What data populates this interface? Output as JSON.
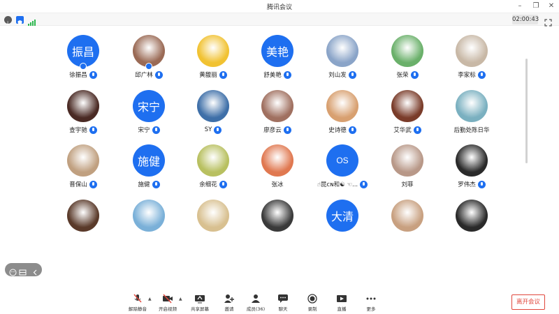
{
  "window": {
    "title": "腾讯会议"
  },
  "status": {
    "timer": "02:00:43",
    "colors": {
      "info": "#555555",
      "shield": "#1e6ff0",
      "signal": "#2eb84f"
    }
  },
  "participants": [
    {
      "name": "徐振昌",
      "avatar_text": "振昌",
      "avatar_type": "text",
      "host": true,
      "mic": "on"
    },
    {
      "name": "邱广林",
      "avatar_type": "photo",
      "avatar_color": "#9a6a55",
      "host": true,
      "mic": "on"
    },
    {
      "name": "黄馥丽",
      "avatar_type": "photo",
      "avatar_color": "#f1c232",
      "mic": "on"
    },
    {
      "name": "舒美艳",
      "avatar_text": "美艳",
      "avatar_type": "text",
      "mic": "on"
    },
    {
      "name": "刘山发",
      "avatar_type": "photo",
      "avatar_color": "#8aa4c8",
      "mic": "on"
    },
    {
      "name": "张荣",
      "avatar_type": "photo",
      "avatar_color": "#6ab06a",
      "mic": "on"
    },
    {
      "name": "李家标",
      "avatar_type": "photo",
      "avatar_color": "#c8b8a6",
      "mic": "on"
    },
    {
      "name": "查宇驰",
      "avatar_type": "photo",
      "avatar_color": "#4a2a24",
      "mic": "on"
    },
    {
      "name": "宋宁",
      "avatar_text": "宋宁",
      "avatar_type": "text",
      "mic": "on"
    },
    {
      "name": "SY",
      "avatar_type": "photo",
      "avatar_color": "#3e6fa8",
      "mic": "on"
    },
    {
      "name": "廖彦云",
      "avatar_type": "photo",
      "avatar_color": "#a07060",
      "mic": "on"
    },
    {
      "name": "史诗德",
      "avatar_type": "photo",
      "avatar_color": "#d8a070",
      "mic": "on"
    },
    {
      "name": "艾华武",
      "avatar_type": "photo",
      "avatar_color": "#7a3c2a",
      "mic": "on"
    },
    {
      "name": "后勤处陈日华",
      "avatar_type": "photo",
      "avatar_color": "#7ab0c0",
      "mic": "none"
    },
    {
      "name": "晋保山",
      "avatar_type": "photo",
      "avatar_color": "#c0a080",
      "mic": "on"
    },
    {
      "name": "施健",
      "avatar_text": "施健",
      "avatar_type": "text",
      "mic": "on"
    },
    {
      "name": "余细花",
      "avatar_type": "photo",
      "avatar_color": "#b8c060",
      "mic": "on"
    },
    {
      "name": "张冰",
      "avatar_type": "photo",
      "avatar_color": "#e07850",
      "mic": "none"
    },
    {
      "name": "☝昆ᴄɴ和☯ ☜...",
      "avatar_text": "OS",
      "avatar_type": "abbr",
      "mic": "on"
    },
    {
      "name": "刘菲",
      "avatar_type": "photo",
      "avatar_color": "#b89888",
      "mic": "none"
    },
    {
      "name": "罗伟杰",
      "avatar_type": "photo",
      "avatar_color": "#2a2a2a",
      "mic": "on"
    },
    {
      "name": "",
      "avatar_type": "photo",
      "avatar_color": "#5a3a2a",
      "mic": "none"
    },
    {
      "name": "",
      "avatar_type": "photo",
      "avatar_color": "#7ab0d8",
      "mic": "none"
    },
    {
      "name": "",
      "avatar_type": "photo",
      "avatar_color": "#d8c090",
      "mic": "none"
    },
    {
      "name": "",
      "avatar_type": "photo",
      "avatar_color": "#3a3a3a",
      "mic": "none"
    },
    {
      "name": "",
      "avatar_text": "大清",
      "avatar_type": "text",
      "mic": "none"
    },
    {
      "name": "",
      "avatar_type": "photo",
      "avatar_color": "#c8a080",
      "mic": "none"
    },
    {
      "name": "",
      "avatar_type": "photo",
      "avatar_color": "#2a2a2a",
      "mic": "none"
    }
  ],
  "toolbar": {
    "unmute": "解除静音",
    "start_video": "开启视频",
    "share_screen": "共享屏幕",
    "invite": "邀请",
    "members": "成员(36)",
    "chat": "聊天",
    "record": "录制",
    "live": "直播",
    "more": "更多",
    "leave": "离开会议"
  },
  "accent": "#1e6ff0",
  "danger": "#e0463b"
}
